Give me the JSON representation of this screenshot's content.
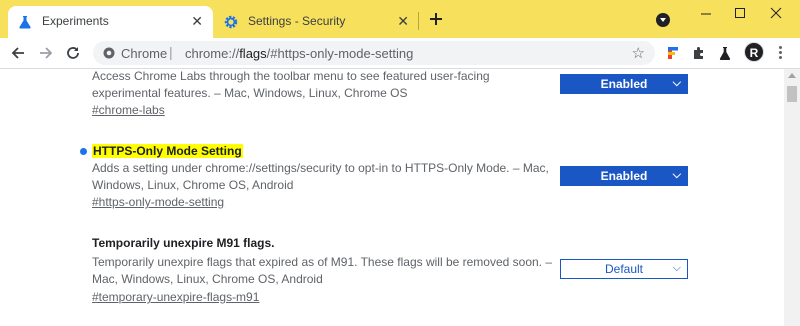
{
  "tabs": [
    {
      "title": "Experiments",
      "icon": "flask-icon",
      "active": true
    },
    {
      "title": "Settings - Security",
      "icon": "settings-gear-icon",
      "active": false
    }
  ],
  "omnibox": {
    "origin": "Chrome",
    "url_prefix": "chrome://",
    "url_host": "flags",
    "url_suffix": "/#https-only-mode-setting"
  },
  "profile": {
    "avatar_letter": "R"
  },
  "flags": [
    {
      "description": "Access Chrome Labs through the toolbar menu to see featured user-facing experimental features. – Mac, Windows, Linux, Chrome OS",
      "link": "#chrome-labs",
      "value": "Enabled"
    },
    {
      "title": "HTTPS-Only Mode Setting",
      "description": "Adds a setting under chrome://settings/security to opt-in to HTTPS-Only Mode. – Mac, Windows, Linux, Chrome OS, Android",
      "link": "#https-only-mode-setting",
      "value": "Enabled"
    },
    {
      "title": "Temporarily unexpire M91 flags.",
      "description": "Temporarily unexpire flags that expired as of M91. These flags will be removed soon. – Mac, Windows, Linux, Chrome OS, Android",
      "link": "#temporary-unexpire-flags-m91",
      "value": "Default"
    }
  ],
  "colors": {
    "tab_strip": "#f7e05b",
    "accent": "#1a56c4",
    "highlight": "#ffff00",
    "modified_dot": "#1a73e8"
  }
}
